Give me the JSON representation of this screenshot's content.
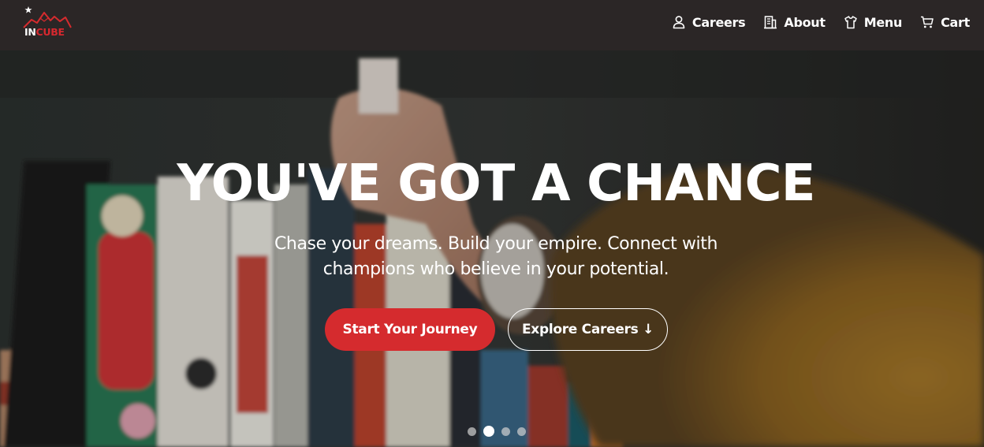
{
  "brand": {
    "logo_text_white": "IN",
    "logo_text_red": "CUBE",
    "accent_color": "#d52b2e"
  },
  "nav": {
    "items": [
      {
        "label": "Careers",
        "icon": "user-icon"
      },
      {
        "label": "About",
        "icon": "building-icon"
      },
      {
        "label": "Menu",
        "icon": "shirt-icon"
      },
      {
        "label": "Cart",
        "icon": "cart-icon"
      }
    ]
  },
  "hero": {
    "title": "YOU'VE GOT A CHANCE",
    "subtitle": "Chase your dreams. Build your empire. Connect with champions who believe in your potential.",
    "primary_button": "Start Your Journey",
    "secondary_button": "Explore Careers ↓",
    "carousel_slide_count": 4,
    "carousel_active_index": 1
  }
}
